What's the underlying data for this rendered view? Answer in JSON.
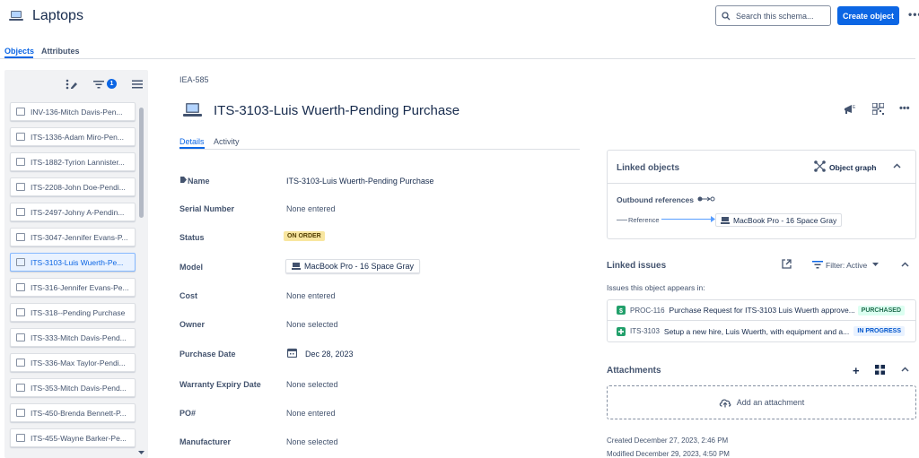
{
  "header": {
    "title": "Laptops",
    "search_placeholder": "Search this schema...",
    "create_button": "Create object",
    "more": "•••"
  },
  "top_tabs": [
    {
      "label": "Objects",
      "active": true
    },
    {
      "label": "Attributes",
      "active": false
    }
  ],
  "left_panel": {
    "filter_count": "1",
    "items": [
      {
        "label": "INV-136-Mitch Davis-Pen..."
      },
      {
        "label": "ITS-1336-Adam Miro-Pen..."
      },
      {
        "label": "ITS-1882-Tyrion Lannister..."
      },
      {
        "label": "ITS-2208-John Doe-Pendi..."
      },
      {
        "label": "ITS-2497-Johny A-Pendin..."
      },
      {
        "label": "ITS-3047-Jennifer Evans-P..."
      },
      {
        "label": "ITS-3103-Luis Wuerth-Pe..."
      },
      {
        "label": "ITS-316-Jennifer Evans-Pe..."
      },
      {
        "label": "ITS-318--Pending Purchase"
      },
      {
        "label": "ITS-333-Mitch Davis-Pend..."
      },
      {
        "label": "ITS-336-Max Taylor-Pendi..."
      },
      {
        "label": "ITS-353-Mitch Davis-Pend..."
      },
      {
        "label": "ITS-450-Brenda Bennett-P..."
      },
      {
        "label": "ITS-455-Wayne Barker-Pe..."
      }
    ],
    "selected_index": 6
  },
  "detail": {
    "key": "IEA-585",
    "title": "ITS-3103-Luis Wuerth-Pending Purchase",
    "tabs": [
      {
        "label": "Details",
        "active": true
      },
      {
        "label": "Activity",
        "active": false
      }
    ],
    "attributes": {
      "name_label": "Name",
      "name_value": "ITS-3103-Luis Wuerth-Pending Purchase",
      "serial_label": "Serial Number",
      "serial_value": "None entered",
      "status_label": "Status",
      "status_value": "ON ORDER",
      "model_label": "Model",
      "model_value": "MacBook Pro - 16 Space Gray",
      "cost_label": "Cost",
      "cost_value": "None entered",
      "owner_label": "Owner",
      "owner_value": "None selected",
      "purchase_date_label": "Purchase Date",
      "purchase_date_value": "Dec 28, 2023",
      "warranty_label": "Warranty Expiry Date",
      "warranty_value": "None selected",
      "po_label": "PO#",
      "po_value": "None entered",
      "manufacturer_label": "Manufacturer",
      "manufacturer_value": "None selected"
    }
  },
  "linked_objects": {
    "title": "Linked objects",
    "graph_button": "Object graph",
    "outbound": "Outbound references",
    "reference_label": "Reference",
    "reference_target": "MacBook Pro - 16 Space Gray"
  },
  "linked_issues": {
    "title": "Linked issues",
    "filter": "Filter: Active",
    "subtitle": "Issues this object appears in:",
    "issues": [
      {
        "key": "PROC-116",
        "summary": "Purchase Request for ITS-3103 Luis Wuerth approve...",
        "status": "PURCHASED"
      },
      {
        "key": "ITS-3103",
        "summary": "Setup a new hire, Luis Wuerth, with equipment and a...",
        "status": "IN PROGRESS"
      }
    ]
  },
  "attachments": {
    "title": "Attachments",
    "add": "Add an attachment",
    "created": "Created December 27, 2023, 2:46 PM",
    "modified": "Modified December 29, 2023, 4:50 PM"
  },
  "colors": {
    "accent": "#0c66e4",
    "status_order": "#f8e6a0",
    "purchased": "#dcfff1",
    "in_progress": "#e9f2ff"
  }
}
